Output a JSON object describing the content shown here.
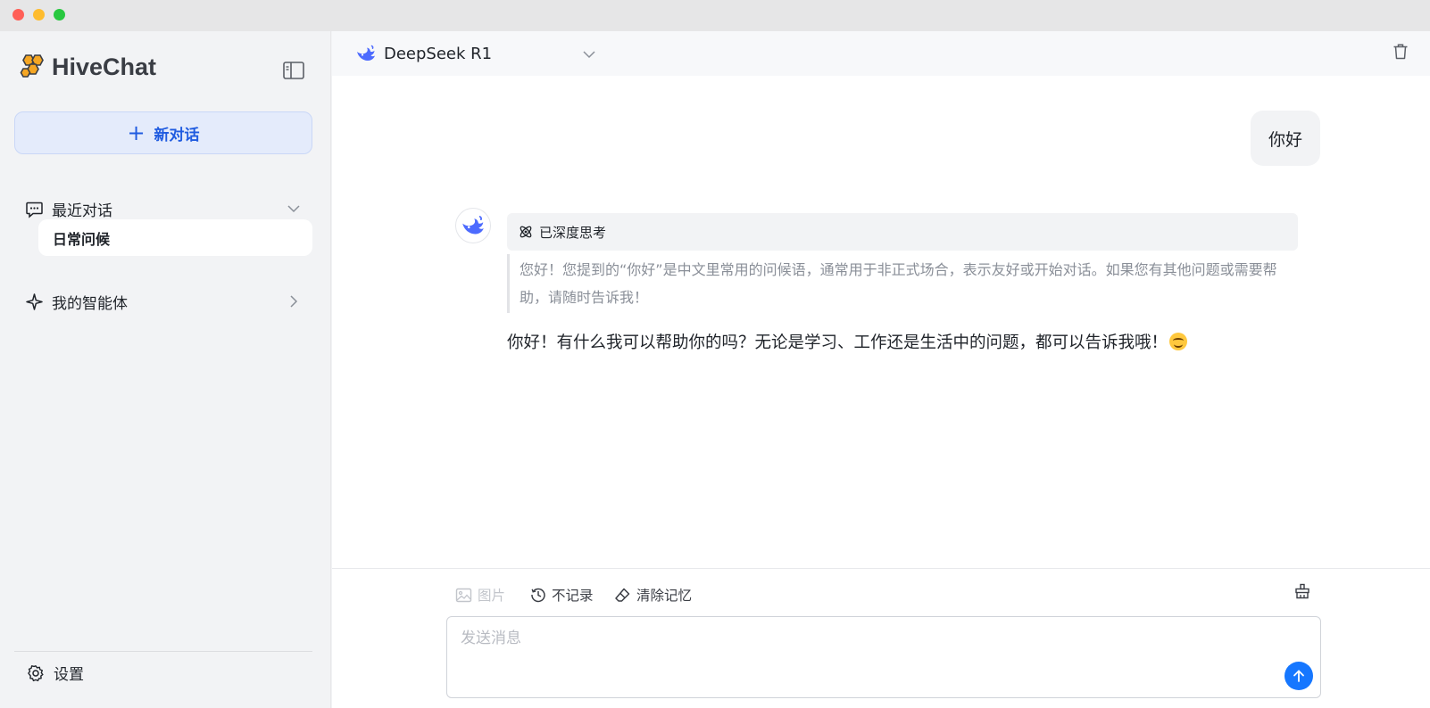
{
  "window": {
    "controls": [
      "close",
      "minimize",
      "zoom"
    ]
  },
  "sidebar": {
    "brand": "HiveChat",
    "new_chat_label": "新对话",
    "recent_label": "最近对话",
    "conversations": [
      {
        "title": "日常问候",
        "active": true
      }
    ],
    "agents_label": "我的智能体",
    "settings_label": "设置"
  },
  "header": {
    "model_name": "DeepSeek R1"
  },
  "chat": {
    "user_message": "你好",
    "assistant": {
      "thinking_label": "已深度思考",
      "thinking_text": "您好！您提到的“你好”是中文里常用的问候语，通常用于非正式场合，表示友好或开始对话。如果您有其他问题或需要帮助，请随时告诉我！",
      "answer": "你好！有什么我可以帮助你的吗？无论是学习、工作还是生活中的问题，都可以告诉我哦！"
    }
  },
  "composer": {
    "image_label": "图片",
    "no_record_label": "不记录",
    "clear_memory_label": "清除记忆",
    "placeholder": "发送消息"
  },
  "colors": {
    "accent": "#1677ff",
    "new_chat_bg": "#e4ebfb",
    "new_chat_text": "#1f5be0",
    "sidebar_bg": "#f2f3f5"
  },
  "icons": {
    "brand": "honeycomb-logo-icon",
    "collapse": "sidebar-toggle-icon",
    "recent": "chat-bubble-icon",
    "agents": "sparkle-icon",
    "settings": "gear-icon",
    "model": "deepseek-whale-icon",
    "delete": "trash-icon",
    "thinking": "atom-icon",
    "image": "image-icon",
    "no_record": "history-icon",
    "clear": "eraser-icon",
    "extra": "broom-icon",
    "send": "arrow-up-icon"
  }
}
